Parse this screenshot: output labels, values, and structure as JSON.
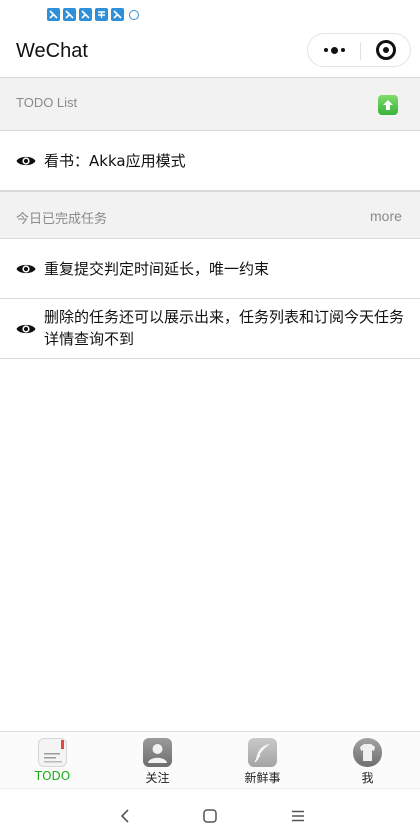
{
  "header": {
    "title": "WeChat"
  },
  "todo_section": {
    "title": "TODO List"
  },
  "todo_items": [
    {
      "text": "看书：Akka应用模式"
    }
  ],
  "done_section": {
    "title": "今日已完成任务",
    "more_label": "more"
  },
  "done_items": [
    {
      "text": "重复提交判定时间延长，唯一约束"
    },
    {
      "text": "删除的任务还可以展示出来，任务列表和订阅今天任务 详情查询不到"
    }
  ],
  "tabs": [
    {
      "label": "TODO",
      "icon": "todo-note-icon",
      "active": true
    },
    {
      "label": "关注",
      "icon": "person-icon",
      "active": false
    },
    {
      "label": "新鲜事",
      "icon": "feather-icon",
      "active": false
    },
    {
      "label": "我",
      "icon": "shirt-icon",
      "active": false
    }
  ],
  "colors": {
    "accent": "#1aad19",
    "section_bg": "#f2f2f2",
    "muted_text": "#8a8a8a"
  }
}
